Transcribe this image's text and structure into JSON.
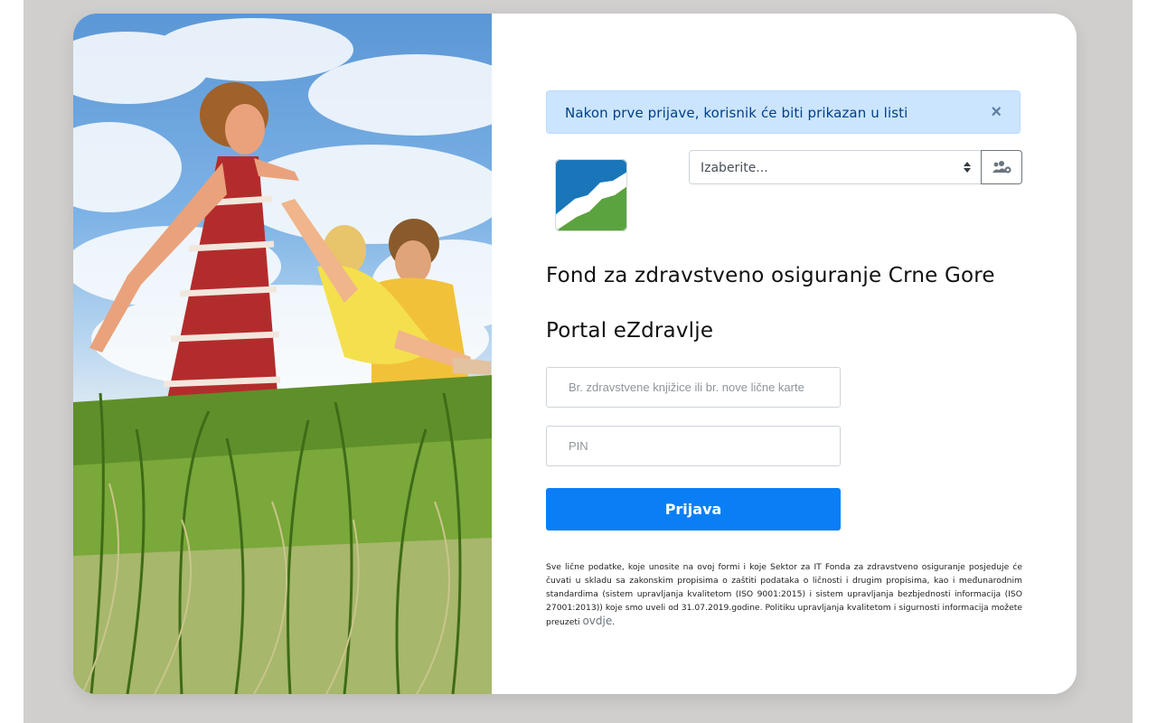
{
  "alert": {
    "message": "Nakon prve prijave, korisnik će biti prikazan u listi",
    "close_symbol": "×"
  },
  "user_select": {
    "selected": "Izaberite..."
  },
  "icons": {
    "alert_close": "close-icon",
    "users_button": "users-cog-icon",
    "select": "sort-arrows-icon",
    "logo": "fzocg-logo"
  },
  "header": {
    "organization": "Fond za zdravstveno osiguranje Crne Gore",
    "portal": "Portal eZdravlje"
  },
  "form": {
    "id_placeholder": "Br. zdravstvene knjižice ili br. nove lične karte",
    "pin_placeholder": "PIN",
    "submit_label": "Prijava"
  },
  "disclaimer": {
    "text": "Sve lične podatke, koje unosite na ovoj formi i koje Sektor za IT Fonda za zdravstveno osiguranje posjeduje će čuvati u skladu sa zakonskim propisima o zaštiti podataka o ličnosti i drugim propisima, kao i međunarodnim standardima (sistem upravljanja kvalitetom (ISO 9001:2015) i sistem upravljanja bezbjednosti informacija (ISO 27001:2013)) koje smo uveli od 31.07.2019.godine. Politiku upravljanja kvalitetom i sigurnosti informacija možete preuzeti ",
    "link_label": "ovdje",
    "end": "."
  },
  "colors": {
    "primary": "#0a7ff5",
    "alert_bg": "#cce5ff",
    "alert_text": "#004085",
    "backdrop": "#d0cfce"
  }
}
